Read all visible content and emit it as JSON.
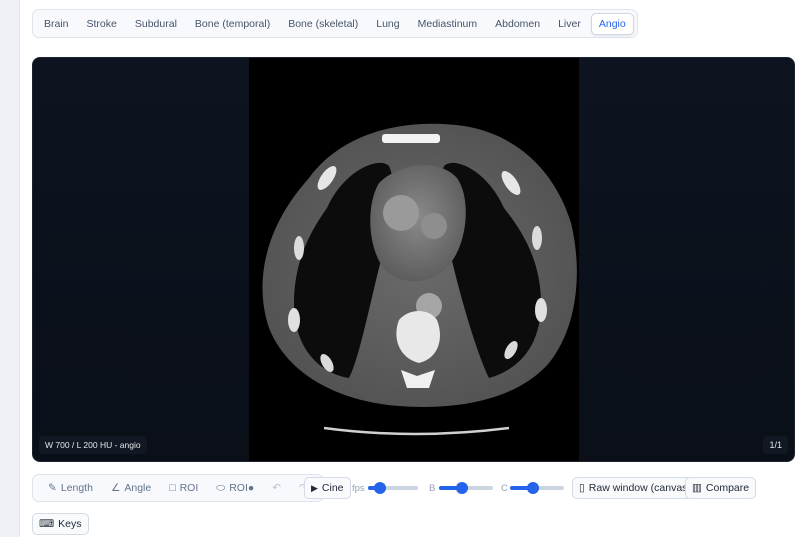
{
  "presets": [
    {
      "label": "Brain",
      "active": false
    },
    {
      "label": "Stroke",
      "active": false
    },
    {
      "label": "Subdural",
      "active": false
    },
    {
      "label": "Bone (temporal)",
      "active": false
    },
    {
      "label": "Bone (skeletal)",
      "active": false
    },
    {
      "label": "Lung",
      "active": false
    },
    {
      "label": "Mediastinum",
      "active": false
    },
    {
      "label": "Abdomen",
      "active": false
    },
    {
      "label": "Liver",
      "active": false
    },
    {
      "label": "Angio",
      "active": true
    }
  ],
  "viewer": {
    "wl_readout": "W 700 / L 200 HU - angio",
    "slice_counter": "1/1"
  },
  "tools": {
    "length": {
      "icon": "✎",
      "label": "Length"
    },
    "angle": {
      "icon": "∠",
      "label": "Angle"
    },
    "roi": {
      "icon": "□",
      "label": "ROI"
    },
    "roi_ellipse": {
      "icon": "⬭",
      "label": "ROI●"
    },
    "undo_icon": "↶",
    "redo_icon": "↷"
  },
  "playback": {
    "cine_icon": "▶",
    "cine_label": "Cine",
    "fps_label": "fps",
    "fps_level": 0.24,
    "brightness_label": "B",
    "brightness_level": 0.42,
    "contrast_label": "C",
    "contrast_level": 0.42
  },
  "actions": {
    "raw_window_icon": "▯",
    "raw_window_label": "Raw window (canvas)",
    "compare_icon": "▥",
    "compare_label": "Compare",
    "keys_icon": "⌨",
    "keys_label": "Keys"
  },
  "colors": {
    "accent": "#2563eb",
    "viewer_bg": "#0b111b"
  }
}
